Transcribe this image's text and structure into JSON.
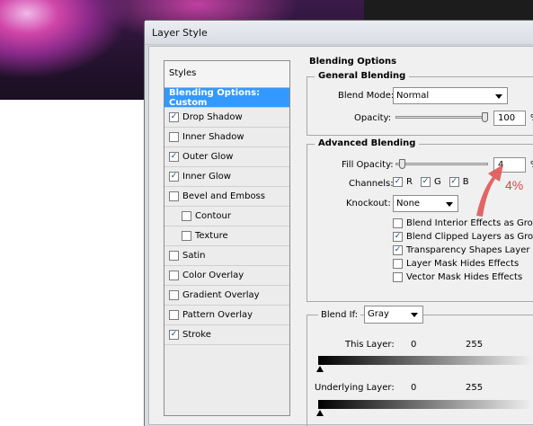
{
  "dialog": {
    "title": "Layer Style"
  },
  "styles": {
    "header": "Styles",
    "items": [
      {
        "label": "Blending Options: Custom",
        "checkbox": false,
        "checked": false,
        "active": true,
        "indent": false
      },
      {
        "label": "Drop Shadow",
        "checkbox": true,
        "checked": true,
        "indent": false
      },
      {
        "label": "Inner Shadow",
        "checkbox": true,
        "checked": false,
        "indent": false
      },
      {
        "label": "Outer Glow",
        "checkbox": true,
        "checked": true,
        "indent": false
      },
      {
        "label": "Inner Glow",
        "checkbox": true,
        "checked": true,
        "indent": false
      },
      {
        "label": "Bevel and Emboss",
        "checkbox": true,
        "checked": false,
        "indent": false
      },
      {
        "label": "Contour",
        "checkbox": true,
        "checked": false,
        "indent": true
      },
      {
        "label": "Texture",
        "checkbox": true,
        "checked": false,
        "indent": true
      },
      {
        "label": "Satin",
        "checkbox": true,
        "checked": false,
        "indent": false
      },
      {
        "label": "Color Overlay",
        "checkbox": true,
        "checked": false,
        "indent": false
      },
      {
        "label": "Gradient Overlay",
        "checkbox": true,
        "checked": false,
        "indent": false
      },
      {
        "label": "Pattern Overlay",
        "checkbox": true,
        "checked": false,
        "indent": false
      },
      {
        "label": "Stroke",
        "checkbox": true,
        "checked": true,
        "indent": false
      }
    ]
  },
  "blending": {
    "title": "Blending Options",
    "general": {
      "title": "General Blending",
      "blend_mode_label": "Blend Mode:",
      "blend_mode_value": "Normal",
      "opacity_label": "Opacity:",
      "opacity_value": "100",
      "opacity_unit": "%",
      "opacity_level": 1.0
    },
    "advanced": {
      "title": "Advanced Blending",
      "fill_opacity_label": "Fill Opacity:",
      "fill_opacity_value": "4",
      "fill_opacity_unit": "%",
      "fill_opacity_level": 0.04,
      "channels_label": "Channels:",
      "channels": [
        {
          "label": "R",
          "checked": true
        },
        {
          "label": "G",
          "checked": true
        },
        {
          "label": "B",
          "checked": true
        }
      ],
      "knockout_label": "Knockout:",
      "knockout_value": "None",
      "options": [
        {
          "label": "Blend Interior Effects as Group",
          "checked": false
        },
        {
          "label": "Blend Clipped Layers as Group",
          "checked": true
        },
        {
          "label": "Transparency Shapes Layer",
          "checked": true
        },
        {
          "label": "Layer Mask Hides Effects",
          "checked": false
        },
        {
          "label": "Vector Mask Hides Effects",
          "checked": false
        }
      ]
    },
    "blend_if": {
      "label": "Blend If:",
      "value": "Gray",
      "this_layer_label": "This Layer:",
      "this_layer_min": "0",
      "this_layer_max": "255",
      "underlying_label": "Underlying Layer:",
      "underlying_min": "0",
      "underlying_max": "255"
    }
  },
  "annotation": {
    "text": "4%",
    "color": "#d24848"
  }
}
